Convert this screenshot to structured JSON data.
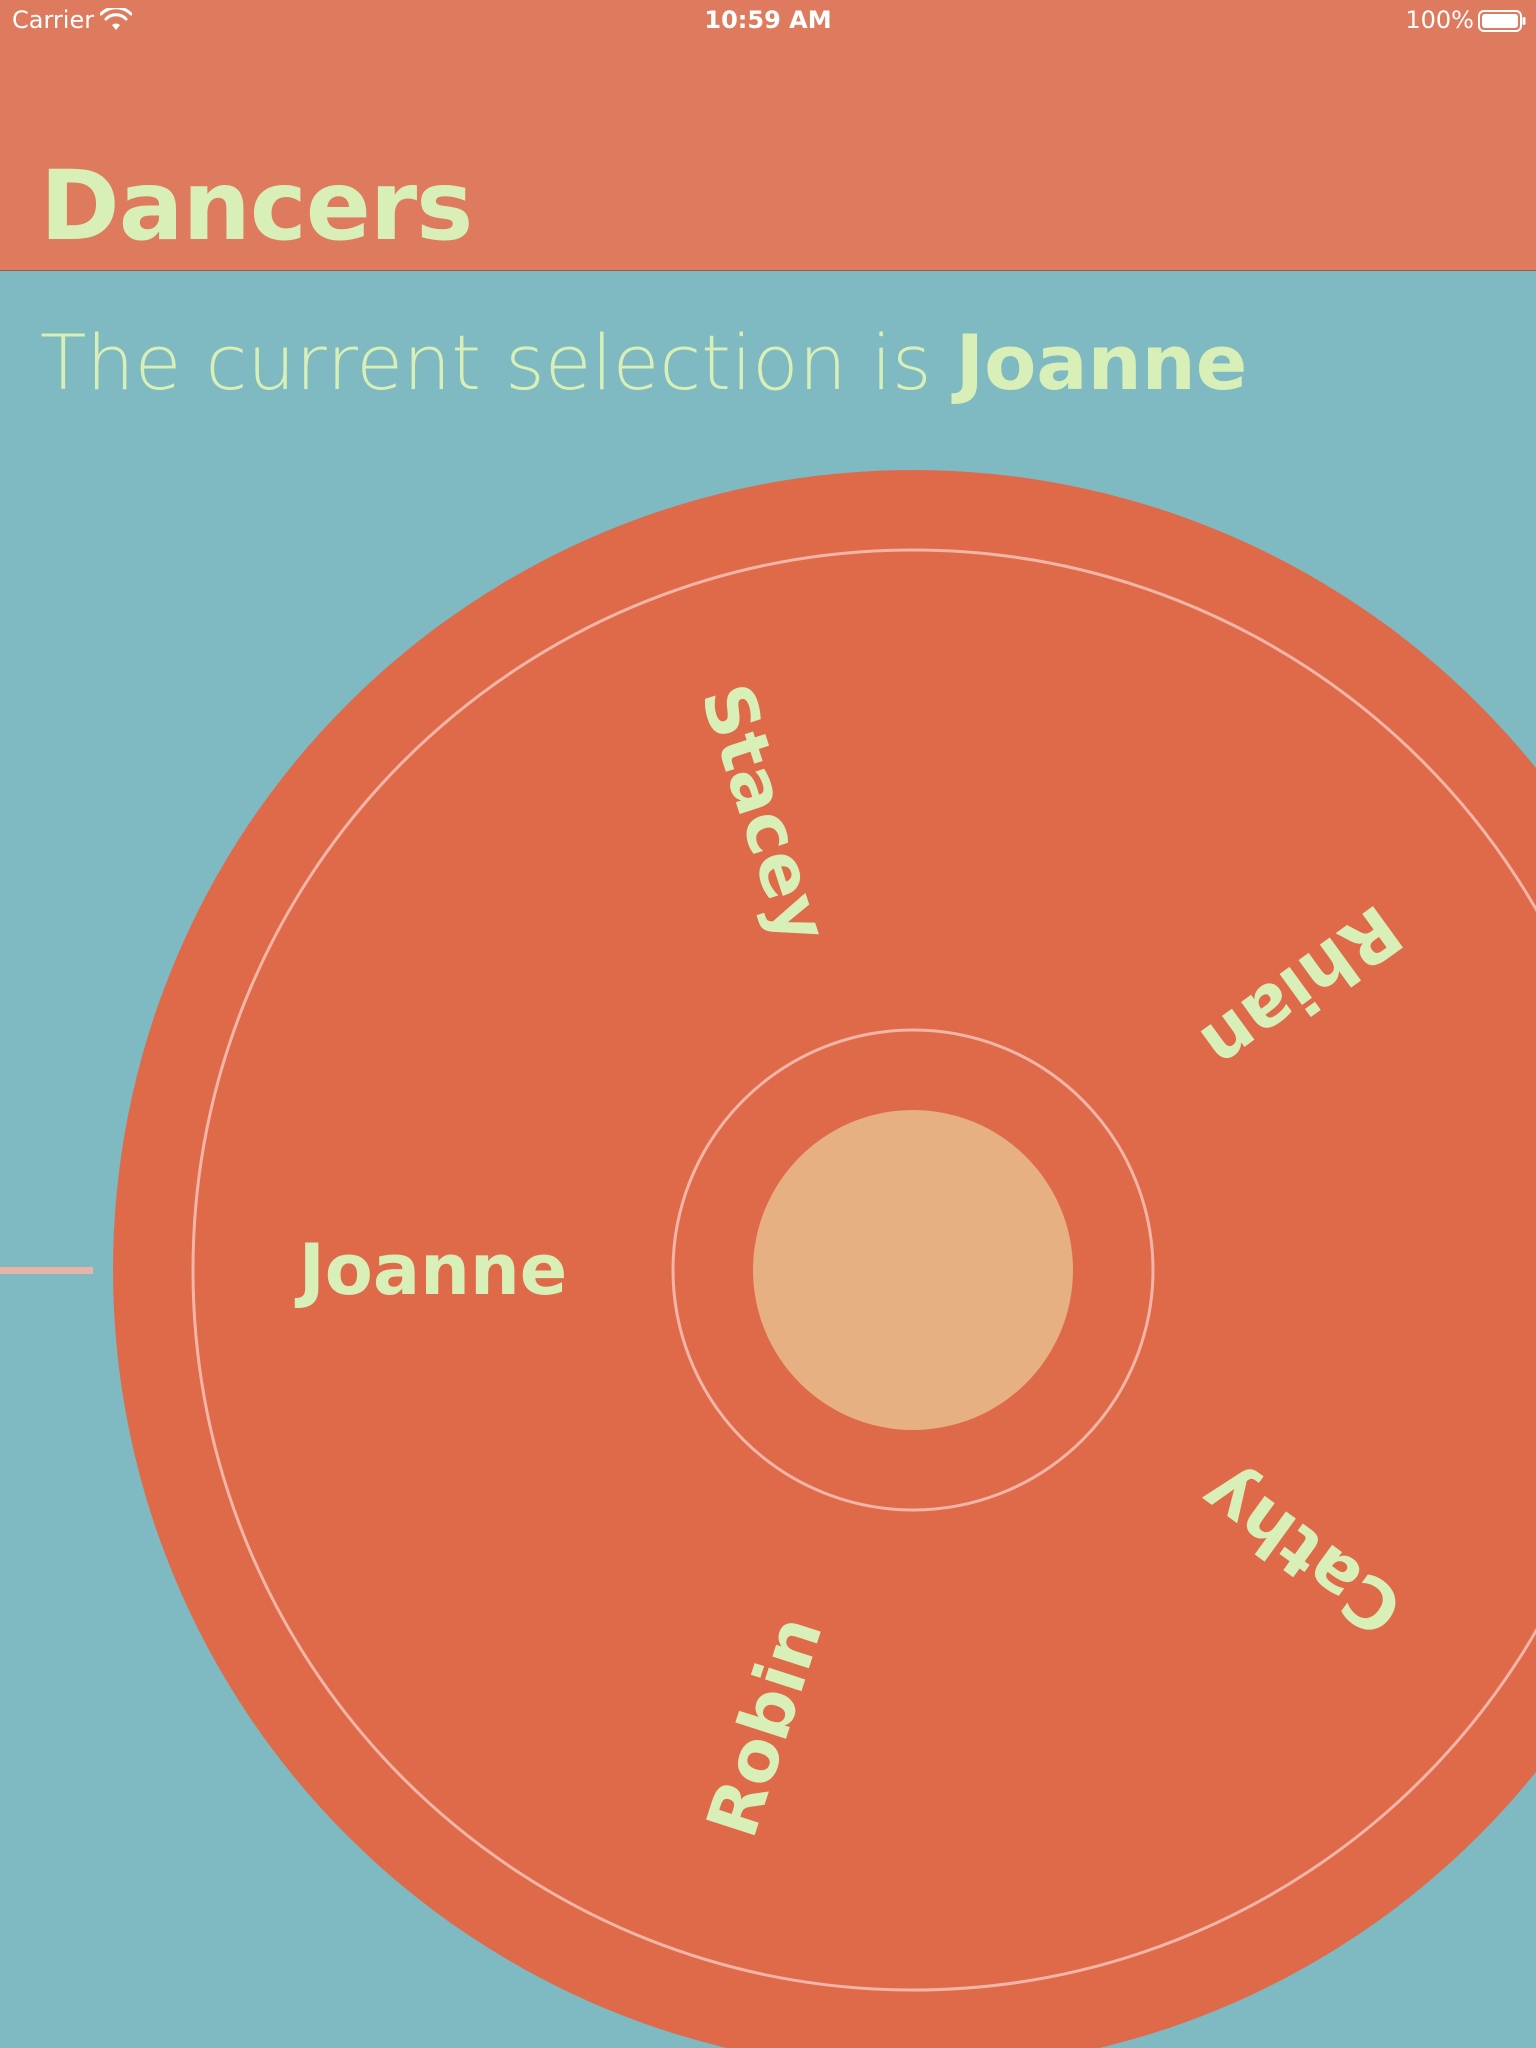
{
  "status_bar": {
    "carrier": "Carrier",
    "time": "10:59 AM",
    "battery": "100%"
  },
  "nav": {
    "title": "Dancers"
  },
  "selection": {
    "prefix": "The current selection is ",
    "value": "Joanne"
  },
  "wheel": {
    "items": [
      {
        "label": "Joanne",
        "angle_deg": 180
      },
      {
        "label": "Stacey",
        "angle_deg": 108
      },
      {
        "label": "Rhian",
        "angle_deg": 36
      },
      {
        "label": "Cathy",
        "angle_deg": -36
      },
      {
        "label": "Robin",
        "angle_deg": -108
      }
    ],
    "selected_index": 0
  },
  "colors": {
    "background": "#7fb9c1",
    "nav_background": "#de7b5e",
    "wheel_fill": "#de6a49",
    "ring_stroke": "#f3b5a7",
    "hub_fill": "#e6b083",
    "text": "#d9efb8"
  }
}
